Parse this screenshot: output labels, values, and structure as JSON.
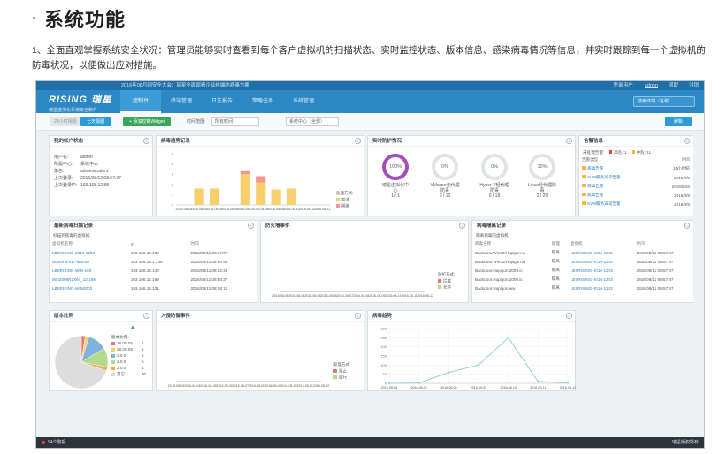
{
  "doc": {
    "title": "系统功能",
    "paragraph": "1、全面直观掌握系统安全状况：管理员能够实时查看到每个客户虚拟机的扫描状态、实时监控状态、版本信息、感染病毒情况等信息，并实时跟踪到每一个虚拟机的防毒状况，以便做出应对措施。"
  },
  "app": {
    "top_message": "2016年08月网安全大会：瑞星全面部署企业终端防病毒方案",
    "top_right": [
      "登录用户:",
      "admin",
      "帮助",
      "注销"
    ],
    "logo_main": "RISING 瑞星",
    "logo_sub": "瑞星虚拟化系统安全软件",
    "nav": [
      "控制台",
      "终端管理",
      "日志报告",
      "策略任务",
      "系统管理"
    ],
    "search_placeholder": "搜索终端（名称）",
    "toolbar": {
      "day_btn": "24小时视图",
      "week_btn": "七天视图",
      "add_btn": "+ 添加控制Widget",
      "period_label": "时间范围:",
      "period_value": "所有时间",
      "center_label": "",
      "center_value": "系统中心（全部）",
      "refresh": "刷新"
    }
  },
  "panels": {
    "account": {
      "title": "我的帐户状态",
      "rows": [
        {
          "k": "用户名:",
          "v": "admin"
        },
        {
          "k": "所属中心:",
          "v": "系统中心"
        },
        {
          "k": "角色:",
          "v": "administrators"
        },
        {
          "k": "上次登录:",
          "v": "2016/08/12 08:57:27"
        },
        {
          "k": "上次登录IP:",
          "v": "193.168.12.88"
        }
      ]
    },
    "virus_trend": {
      "title": "病毒趋势记录"
    },
    "protection": {
      "title": "实时防护情况",
      "items": [
        {
          "pct": "100%",
          "label": "瑞星虚拟化中心",
          "value": "1 / 1",
          "full": true
        },
        {
          "pct": "0%",
          "label": "VMware无代理防毒",
          "value": "0 / 10",
          "full": false
        },
        {
          "pct": "0%",
          "label": "Hyper-V轻代理防毒",
          "value": "0 / 18",
          "full": false
        },
        {
          "pct": "10%",
          "label": "Linux轻代理防毒",
          "value": "2 / 20",
          "full": false
        }
      ]
    },
    "alerts": {
      "title": "告警信息",
      "summary": [
        "未处理告警:",
        "高危: 1",
        "中危: 11"
      ],
      "head": [
        "告警类型",
        "时间"
      ],
      "rows": [
        {
          "a": "病毒告警",
          "t": "15小时前"
        },
        {
          "a": "SVM服务异常告警",
          "t": "2016/8/9"
        },
        {
          "a": "病毒告警",
          "t": "2016/8/10"
        },
        {
          "a": "病毒告警",
          "t": "2016/8/9"
        },
        {
          "a": "SVM服务异常告警",
          "t": "2016/8/9"
        }
      ]
    },
    "recent_scan": {
      "title": "最新病毒扫描记录",
      "subtitle": "扫描到病毒的虚拟机:",
      "head": [
        "虚拟机名称",
        "IP",
        "时间"
      ],
      "rows": [
        [
          "LBSRISING-2016-1203",
          "193.168.12.135",
          "2016/08/11 08:57:07"
        ],
        [
          "cluster-vm17-a85f36",
          "193.168.29.1.136",
          "2016/08/11 08:30:43"
        ],
        [
          "LBSRISING-WIN-160",
          "193.168.12.140",
          "2016/08/11 08:12:48"
        ],
        [
          "Win2008R2X64_12.199",
          "193.168.12.199",
          "2016/08/11 08:30:27"
        ],
        [
          "LBSRISING-WIN2003",
          "193.168.12.131",
          "2016/08/11 08:28:10"
        ]
      ]
    },
    "events": {
      "title": "防火墙事件"
    },
    "recent_bak": {
      "title": "病毒隔离记录",
      "subtitle": "隔离病毒的虚拟机:",
      "head": [
        "病毒名称",
        "处理",
        "虚拟机",
        "时间"
      ],
      "rows": [
        [
          "Backdoor.Win32/Hupigon.w",
          "隔离",
          "LBSRISING-2016-1203",
          "2016/08/11 08:57:07"
        ],
        [
          "Backdoor.Win32/Hupigon.w",
          "隔离",
          "LBSRISING-2016-1203",
          "2016/08/11 08:57:07"
        ],
        [
          "Backdoor.Hupigon.2009.ic",
          "隔离",
          "LBSRISING-2016-1203",
          "2016/08/11 08:57:07"
        ],
        [
          "Backdoor.Hupigon.2009.ic",
          "隔离",
          "LBSRISING-2016-1203",
          "2016/08/11 08:57:07"
        ],
        [
          "Backdoor.Hupigon.ww",
          "隔离",
          "LBSRISING-2016-1203",
          "2016/08/11 08:57:07"
        ]
      ]
    },
    "version": {
      "title": "版本比例",
      "legend_title": "版本比例:",
      "legend": [
        {
          "name": "28.00.05",
          "count": "1",
          "color": "#e87777"
        },
        {
          "name": "28.00.08",
          "count": "1",
          "color": "#f5d36b"
        },
        {
          "name": "2.0.0.",
          "count": "5",
          "color": "#7fb3df"
        },
        {
          "name": "2.0.0.",
          "count": "5",
          "color": "#b3d98a"
        },
        {
          "name": "2.0.0.",
          "count": "1",
          "color": "#f7a54b"
        },
        {
          "name": "其它",
          "count": "30",
          "color": "#dddddd"
        }
      ]
    },
    "intrusion": {
      "title": "入侵防御事件"
    },
    "virus_scan": {
      "title": "病毒趋势"
    }
  },
  "chart_data": [
    {
      "type": "bar",
      "title": "病毒趋势记录",
      "categories": [
        "2016-08-03",
        "2016-08-04",
        "2016-08-05",
        "2016-08-06",
        "2016-08-07",
        "2016-08-08",
        "2016-08-09",
        "2016-08-10",
        "2016-08-11",
        "2016-08-12"
      ],
      "series": [
        {
          "name": "普通",
          "values": [
            0,
            1.6,
            1.6,
            0,
            3,
            2.2,
            1.5,
            1.6,
            0,
            0
          ],
          "color": "#f7cf6b"
        },
        {
          "name": "隔离",
          "values": [
            0,
            0,
            0,
            0,
            0.3,
            0.6,
            0,
            0,
            0,
            0
          ],
          "color": "#f49494"
        }
      ],
      "yticks": [
        0,
        1,
        2,
        3,
        4,
        5
      ],
      "ylim": [
        0,
        5
      ],
      "legend_title": "处理方式:",
      "legend": [
        "普通",
        "隔离"
      ]
    },
    {
      "type": "line",
      "title": "防火墙事件",
      "categories": [
        "2016-08-03",
        "2016-08-04",
        "2016-08-05",
        "2016-08-06",
        "2016-08-07",
        "2016-08-08",
        "2016-08-09",
        "2016-08-10",
        "2016-08-11",
        "2016-08-12"
      ],
      "series": [
        {
          "name": "拦截",
          "values": [
            0,
            0,
            0,
            0,
            0,
            0,
            0,
            0,
            0,
            0
          ],
          "color": "#e87777"
        }
      ],
      "legend_title": "防护方式:",
      "legend": [
        "拦截",
        "允许"
      ]
    },
    {
      "type": "line",
      "title": "入侵防御事件",
      "categories": [
        "2016-08-03",
        "2016-08-04",
        "2016-08-05",
        "2016-08-06",
        "2016-08-07",
        "2016-08-08",
        "2016-08-09",
        "2016-08-10",
        "2016-08-11",
        "2016-08-12"
      ],
      "series": [
        {
          "name": "阻止",
          "values": [
            0,
            0,
            0,
            0,
            0,
            0,
            0,
            0,
            0,
            0
          ],
          "color": "#e87777"
        }
      ],
      "legend_title": "处理方式:",
      "legend": [
        "阻止",
        "放行"
      ]
    },
    {
      "type": "line",
      "title": "病毒趋势",
      "categories": [
        "2016-08-06",
        "2016-08-07",
        "2016-08-08",
        "2016-08-09",
        "2016-08-10",
        "2016-08-11",
        "2016-08-12"
      ],
      "values": [
        0,
        2,
        60,
        100,
        250,
        10,
        3
      ],
      "color": "#8fd0d8",
      "yticks": [
        0,
        50,
        100,
        150,
        200,
        250,
        300
      ],
      "ylim": [
        0,
        300
      ]
    },
    {
      "type": "pie",
      "title": "版本比例",
      "labels": [
        "28.00.05",
        "28.00.08",
        "2.0.0.",
        "2.0.0.",
        "2.0.0.",
        "其它"
      ],
      "values": [
        1,
        1,
        5,
        5,
        1,
        30
      ]
    }
  ],
  "status": {
    "left": "94个警报",
    "right": "瑞星版权所有"
  }
}
